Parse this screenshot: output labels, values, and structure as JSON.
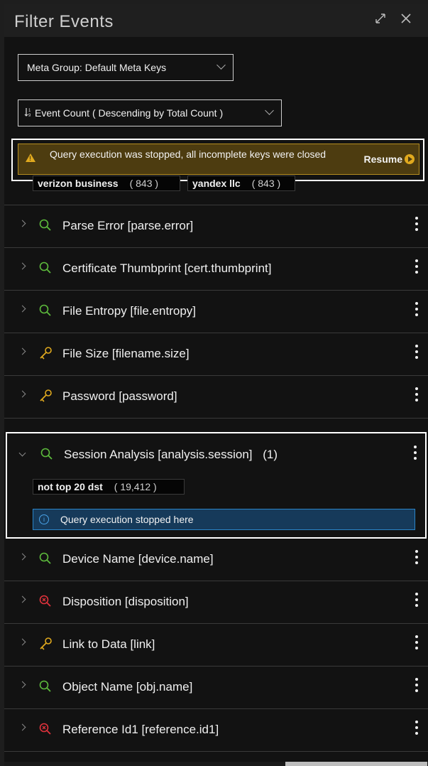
{
  "header": {
    "title": "Filter Events"
  },
  "meta_group": {
    "label": "Meta Group: Default Meta Keys"
  },
  "sort": {
    "label": "Event Count ( Descending by Total Count )"
  },
  "warning": {
    "text": "Query execution was stopped, all incomplete keys were closed",
    "resume_label": "Resume"
  },
  "top_values": [
    {
      "value": "verizon business",
      "count": "( 843 )"
    },
    {
      "value": "yandex llc",
      "count": "( 843 )"
    }
  ],
  "keys": [
    {
      "label": "Parse Error [parse.error]",
      "icon": "search-icon"
    },
    {
      "label": "Certificate Thumbprint [cert.thumbprint]",
      "icon": "search-icon"
    },
    {
      "label": "File Entropy [file.entropy]",
      "icon": "search-icon"
    },
    {
      "label": "File Size [filename.size]",
      "icon": "key-icon"
    },
    {
      "label": "Password [password]",
      "icon": "key-icon"
    },
    {
      "label": "Device Name [device.name]",
      "icon": "search-icon"
    },
    {
      "label": "Disposition [disposition]",
      "icon": "error-search-icon"
    },
    {
      "label": "Link to Data [link]",
      "icon": "key-icon"
    },
    {
      "label": "Object Name [obj.name]",
      "icon": "search-icon"
    },
    {
      "label": "Reference Id1 [reference.id1]",
      "icon": "error-search-icon"
    }
  ],
  "session": {
    "label": "Session Analysis [analysis.session]",
    "count": "(1)",
    "value": "not top 20 dst",
    "value_count": "( 19,412 )",
    "info": "Query execution stopped here"
  },
  "colors": {
    "search": "#5dbb3c",
    "key": "#e0a91e",
    "error": "#e0323c",
    "warning_bg": "#4d3c10",
    "info_bg": "#163a5a"
  }
}
